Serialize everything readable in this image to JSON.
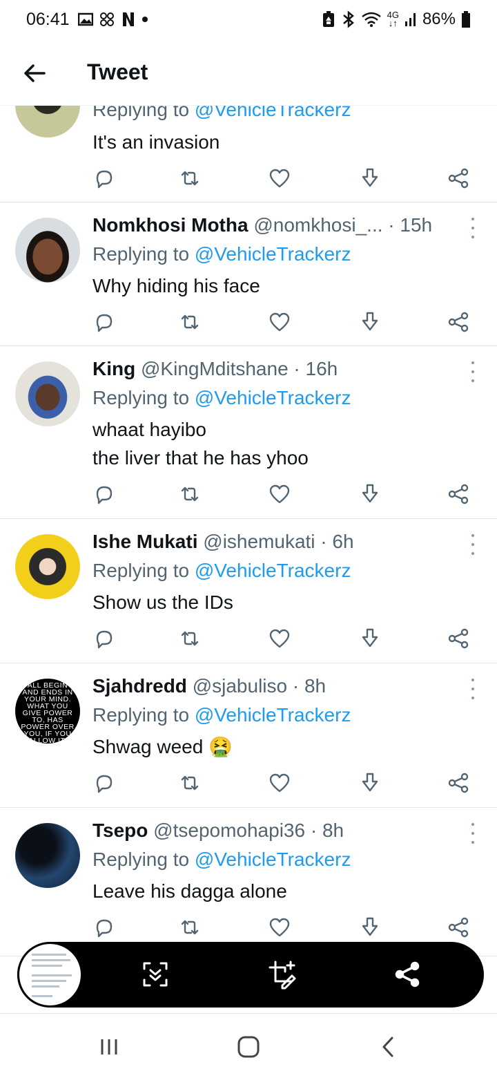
{
  "status_bar": {
    "time": "06:41",
    "network": "4G",
    "battery": "86%",
    "icons": [
      "gallery-icon",
      "pinwheel-icon",
      "netflix-n-icon",
      "dot-icon",
      "battery-saver-icon",
      "bluetooth-icon",
      "wifi-icon",
      "signal-icon",
      "battery-icon"
    ]
  },
  "header": {
    "title": "Tweet"
  },
  "partial_tweet": {
    "replying_prefix": "Replying to ",
    "mention": "@VehicleTrackerz",
    "text": "It's an invasion"
  },
  "tweets": [
    {
      "name": "Nomkhosi Motha",
      "handle": "@nomkhosi_...",
      "time": " · 15h",
      "replying_prefix": "Replying to ",
      "mention": "@VehicleTrackerz",
      "lines": [
        "Why hiding his face"
      ]
    },
    {
      "name": "King",
      "handle": "@KingMditshane",
      "time": " · 16h",
      "replying_prefix": "Replying to ",
      "mention": "@VehicleTrackerz",
      "lines": [
        "whaat hayibo",
        "the liver that he has yhoo"
      ]
    },
    {
      "name": "Ishe Mukati",
      "handle": "@ishemukati",
      "time": " · 6h",
      "replying_prefix": "Replying to ",
      "mention": "@VehicleTrackerz",
      "lines": [
        "Show us the IDs"
      ]
    },
    {
      "name": "Sjahdredd",
      "handle": "@sjabuliso",
      "time": " · 8h",
      "replying_prefix": "Replying to ",
      "mention": "@VehicleTrackerz",
      "lines": [
        "Shwag weed 🤮"
      ],
      "avatar_text": [
        "ALL BEGIN",
        "AND ENDS IN",
        "YOUR MIND.",
        "WHAT YOU",
        "GIVE POWER",
        "TO, HAS",
        "POWER OVER",
        "YOU, IF YOU",
        "ALLOW IT."
      ]
    },
    {
      "name": "Tsepo",
      "handle": "@tsepomohapi36",
      "time": " · 8h",
      "replying_prefix": "Replying to ",
      "mention": "@VehicleTrackerz",
      "lines": [
        "Leave his dagga alone"
      ]
    }
  ],
  "action_icons": [
    "reply-icon",
    "retweet-icon",
    "like-icon",
    "download-icon",
    "share-icon"
  ],
  "capture_toolbar": {
    "icons": [
      "scroll-capture-icon",
      "crop-edit-icon",
      "share-icon"
    ]
  },
  "nav_bar": {
    "icons": [
      "recents-icon",
      "home-icon",
      "back-icon"
    ]
  },
  "colors": {
    "accent": "#1d9bf0",
    "secondary_text": "#536471",
    "divider": "#e1e5e8"
  }
}
